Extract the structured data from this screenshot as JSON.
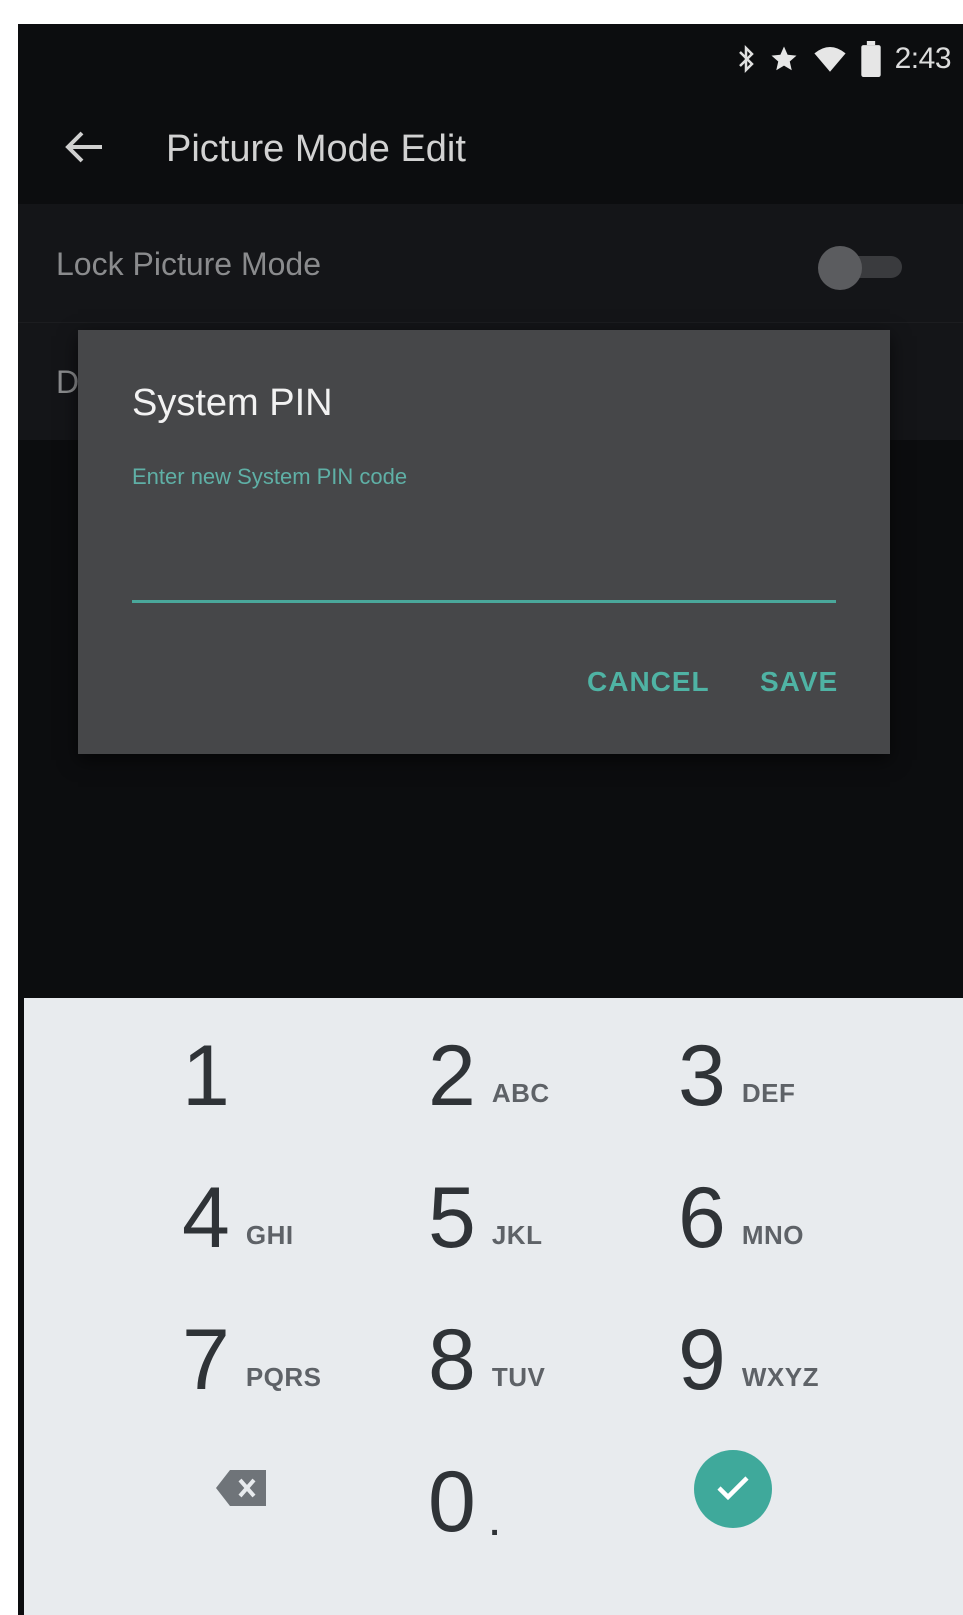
{
  "status_bar": {
    "time": "2:43",
    "icons": [
      "bluetooth-icon",
      "star-icon",
      "wifi-icon",
      "battery-icon"
    ]
  },
  "toolbar": {
    "back_icon": "arrow-back-icon",
    "title": "Picture Mode Edit"
  },
  "settings": {
    "items": [
      {
        "label": "Lock Picture Mode",
        "toggle_on": false
      },
      {
        "label": "D"
      }
    ]
  },
  "dialog": {
    "title": "System PIN",
    "hint": "Enter new System PIN code",
    "input_value": "",
    "cancel_label": "CANCEL",
    "save_label": "SAVE"
  },
  "keypad": {
    "keys": [
      {
        "digit": "1",
        "letters": ""
      },
      {
        "digit": "2",
        "letters": "ABC"
      },
      {
        "digit": "3",
        "letters": "DEF"
      },
      {
        "digit": "4",
        "letters": "GHI"
      },
      {
        "digit": "5",
        "letters": "JKL"
      },
      {
        "digit": "6",
        "letters": "MNO"
      },
      {
        "digit": "7",
        "letters": "PQRS"
      },
      {
        "digit": "8",
        "letters": "TUV"
      },
      {
        "digit": "9",
        "letters": "WXYZ"
      },
      {
        "digit": "0",
        "letters": "."
      }
    ],
    "backspace_icon": "backspace-icon",
    "done_icon": "check-icon"
  },
  "colors": {
    "accent": "#4fb3a4",
    "dialog_bg": "#464749",
    "screen_bg": "#0c0d0f",
    "keypad_bg": "#e8ebee"
  }
}
